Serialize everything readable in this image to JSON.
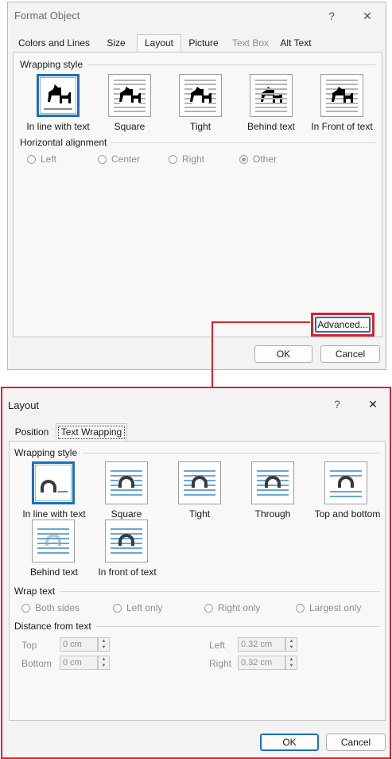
{
  "dialog1": {
    "title": "Format Object",
    "tabs": [
      "Colors and Lines",
      "Size",
      "Layout",
      "Picture",
      "Text Box",
      "Alt Text"
    ],
    "wrapping_style_label": "Wrapping style",
    "wrap_options": [
      "In line with text",
      "Square",
      "Tight",
      "Behind text",
      "In Front of text"
    ],
    "horizontal_alignment_label": "Horizontal alignment",
    "alignment_options": [
      "Left",
      "Center",
      "Right",
      "Other"
    ],
    "advanced_label": "Advanced...",
    "ok_label": "OK",
    "cancel_label": "Cancel"
  },
  "dialog2": {
    "title": "Layout",
    "tabs": [
      "Position",
      "Text Wrapping"
    ],
    "wrapping_style_label": "Wrapping style",
    "wrap_options": [
      "In line with text",
      "Square",
      "Tight",
      "Through",
      "Top and bottom",
      "Behind text",
      "In front of text"
    ],
    "wrap_text_label": "Wrap text",
    "wrap_text_options": [
      "Both sides",
      "Left only",
      "Right only",
      "Largest only"
    ],
    "distance_label": "Distance from text",
    "top_label": "Top",
    "top_value": "0 cm",
    "bottom_label": "Bottom",
    "bottom_value": "0 cm",
    "left_label": "Left",
    "left_value": "0.32 cm",
    "right_label": "Right",
    "right_value": "0.32 cm",
    "ok_label": "OK",
    "cancel_label": "Cancel"
  },
  "colors": {
    "highlight": "#d9232e",
    "accent": "#1f6fb5"
  }
}
